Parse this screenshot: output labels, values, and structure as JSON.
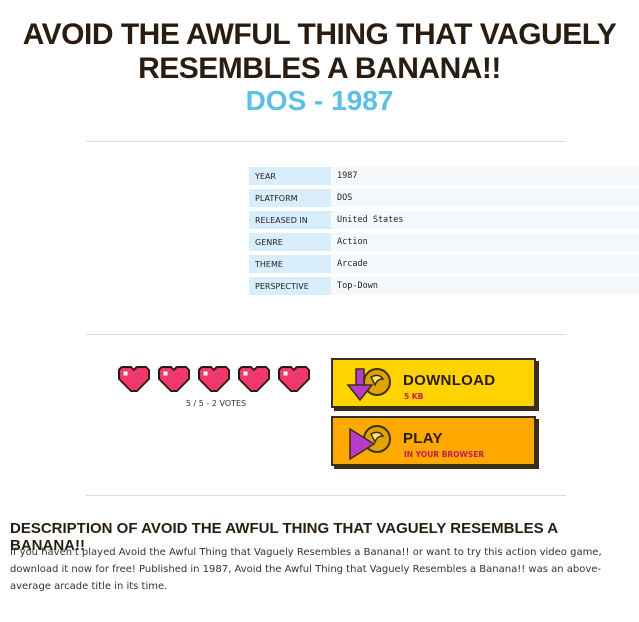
{
  "game": {
    "title": "AVOID THE AWFUL THING THAT VAGUELY RESEMBLES A BANANA!!",
    "subtitle": "DOS - 1987"
  },
  "info": {
    "rows": [
      {
        "label": "YEAR",
        "value": "1987"
      },
      {
        "label": "PLATFORM",
        "value": "DOS"
      },
      {
        "label": "RELEASED IN",
        "value": "United States"
      },
      {
        "label": "GENRE",
        "value": "Action"
      },
      {
        "label": "THEME",
        "value": "Arcade"
      },
      {
        "label": "PERSPECTIVE",
        "value": "Top-Down"
      }
    ]
  },
  "rating": {
    "stars": 5,
    "max": 5,
    "votes_text": "5 / 5 - 2 VOTES",
    "heart_color": "#f0386b"
  },
  "buttons": {
    "download": {
      "label": "DOWNLOAD",
      "sub": "5 KB",
      "bg": "#ffd200",
      "icon": "download-arrow-icon"
    },
    "play": {
      "label": "PLAY",
      "sub": "IN YOUR BROWSER",
      "bg": "#ffa800",
      "icon": "play-triangle-icon"
    }
  },
  "description": {
    "heading": "DESCRIPTION OF AVOID THE AWFUL THING THAT VAGUELY RESEMBLES A BANANA!!",
    "text": "If you haven't played Avoid the Awful Thing that Vaguely Resembles a Banana!! or want to try this action video game, download it now for free! Published in 1987, Avoid the Awful Thing that Vaguely Resembles a Banana!! was an above-average arcade title in its time."
  }
}
